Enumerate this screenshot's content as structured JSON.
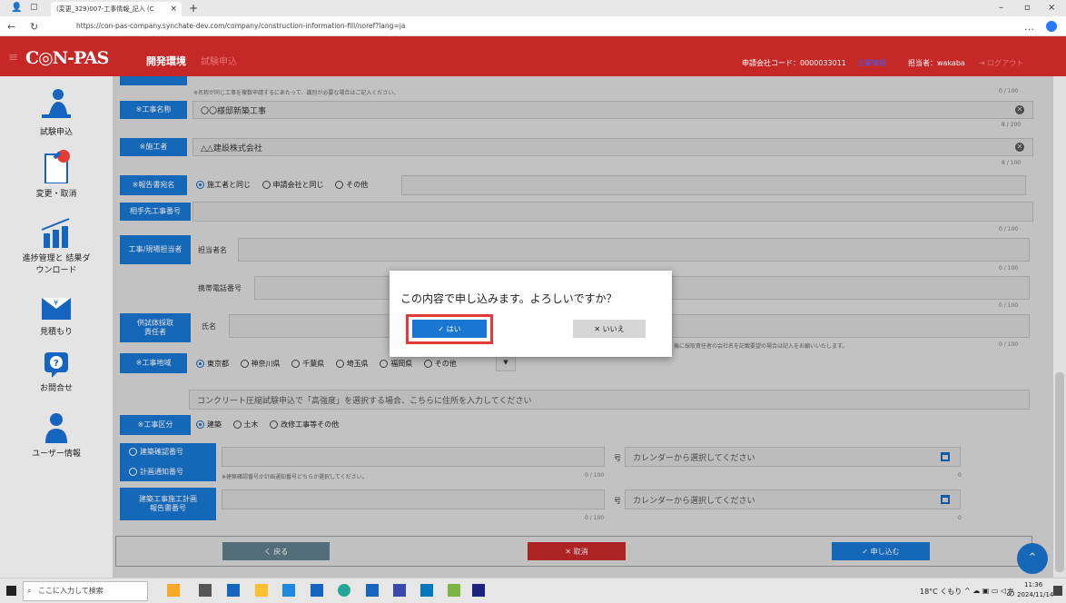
{
  "browser": {
    "tab_title": "(変更_329)007-工事情報_記入 (C",
    "url": "https://con-pas-company.synchate-dev.com/company/construction-information-fill/noref?lang=ja"
  },
  "header": {
    "brand": "C◎N-PAS",
    "env": "開発環境",
    "page": "試験申込",
    "company_code": "申請会社コード：0000033011",
    "hidden_label": "企業情報",
    "user": "担当者：wakaba",
    "logout": "ログアウト"
  },
  "sidebar": {
    "items": [
      {
        "label": "試験申込"
      },
      {
        "label": "変更・取消"
      },
      {
        "label": "進捗管理と 結果ダ"
      },
      {
        "label": "ウンロード"
      },
      {
        "label": "見積もり"
      },
      {
        "label": "お問合せ"
      },
      {
        "label": "ユーザー情報"
      }
    ]
  },
  "form": {
    "top_hint": "※名称が同じ工事を複数申請するにあたって、識別が必要な場合はご記入ください。",
    "top_count": "0 / 100",
    "project_name": {
      "label": "※工事名称",
      "value": "〇〇様邸新築工事",
      "count": "8 / 200"
    },
    "contractor": {
      "label": "※施工者",
      "value": "△△建設株式会社",
      "count": "8 / 100"
    },
    "report_to": {
      "label": "※報告書宛名",
      "options": [
        "施工者と同じ",
        "申請会社と同じ",
        "その他"
      ]
    },
    "partner_no": {
      "label": "相手先工事番号",
      "count": "0 / 100"
    },
    "site_manager": {
      "label": "工事/現場担当者",
      "name_label": "担当者名",
      "phone_label": "携帯電話番号",
      "count": "0 / 100"
    },
    "witness": {
      "label": "供試体採取\n責任者",
      "name_label": "氏名",
      "note": "機に採取責任者の会社名を記載要望の場合は記入をお願いいたします。",
      "count": "0 / 100"
    },
    "area": {
      "label": "※工事地域",
      "options": [
        "東京都",
        "神奈川県",
        "千葉県",
        "埼玉県",
        "福岡県",
        "その他"
      ]
    },
    "address_placeholder": "コンクリート圧縮試験申込で「高強度」を選択する場合、こちらに住所を入力してください",
    "category": {
      "label": "※工事区分",
      "options": [
        "建築",
        "土木",
        "改修工事等その他"
      ]
    },
    "confirm_no": {
      "label": "建築確認番号",
      "notice_label": "計画通知番号",
      "hint": "※建築確認番号か計画通知番号どちらか選択してください。",
      "count": "0 / 100",
      "suffix": "号",
      "date_placeholder": "カレンダーから選択してください",
      "date_count": "0"
    },
    "plan_report": {
      "label": "建築工事施工計画\n報告書番号",
      "count": "0 / 100",
      "suffix": "号",
      "date_placeholder": "カレンダーから選択してください",
      "date_count": "0"
    }
  },
  "buttons": {
    "back": "く 戻る",
    "cancel": "✕ 取消",
    "submit": "✓ 申し込む"
  },
  "dialog": {
    "message": "この内容で申し込みます。よろしいですか？",
    "yes": "✓ はい",
    "no": "✕ いいえ"
  },
  "taskbar": {
    "search": "ここに入力して検索",
    "weather": "18°C くもり",
    "ime": "あ",
    "time": "11:36",
    "date": "2024/11/14"
  },
  "colors": {
    "brand_red": "#c62828",
    "primary_blue": "#1976d2",
    "highlight": "#e53935"
  }
}
